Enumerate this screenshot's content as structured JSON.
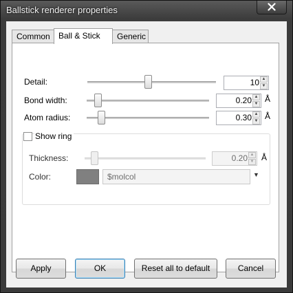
{
  "window": {
    "title": "Ballstick renderer properties"
  },
  "tabs": [
    {
      "label": "Common"
    },
    {
      "label": "Ball & Stick",
      "active": true
    },
    {
      "label": "Generic"
    }
  ],
  "detail": {
    "label": "Detail:",
    "value": "10",
    "slider_fraction": 0.47
  },
  "bond_width": {
    "label": "Bond width:",
    "value": "0.20",
    "unit": "Å",
    "slider_fraction": 0.09
  },
  "atom_radius": {
    "label": "Atom radius:",
    "value": "0.30",
    "unit": "Å",
    "slider_fraction": 0.12
  },
  "ring": {
    "checkbox_label": "Show ring",
    "checked": false,
    "thickness": {
      "label": "Thickness:",
      "value": "0.20",
      "unit": "Å",
      "slider_fraction": 0.08
    },
    "color": {
      "label": "Color:",
      "swatch": "#808080",
      "value": "$molcol"
    }
  },
  "buttons": {
    "apply": "Apply",
    "ok": "OK",
    "reset": "Reset all to default",
    "cancel": "Cancel"
  },
  "icons": {
    "close": "close-icon",
    "spin_up": "spin-up-icon",
    "spin_down": "spin-down-icon",
    "dropdown": "chevron-down-icon"
  }
}
